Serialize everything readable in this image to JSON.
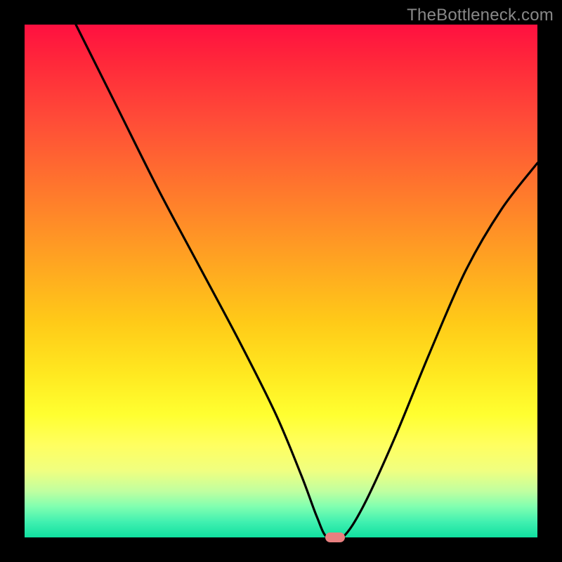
{
  "watermark": "TheBottleneck.com",
  "chart_data": {
    "type": "line",
    "title": "",
    "xlabel": "",
    "ylabel": "",
    "xlim": [
      0,
      100
    ],
    "ylim": [
      0,
      100
    ],
    "grid": false,
    "legend": false,
    "series": [
      {
        "name": "curve",
        "x": [
          10,
          18,
          26,
          34,
          42,
          49,
          54,
          57,
          59,
          62,
          66,
          72,
          79,
          86,
          93,
          100
        ],
        "y": [
          100,
          84,
          68,
          53,
          38,
          24,
          12,
          4,
          0,
          0,
          6,
          19,
          36,
          52,
          64,
          73
        ]
      }
    ],
    "marker": {
      "x": 60.5,
      "y": 0
    },
    "gradient_stops": [
      {
        "pos": 0.0,
        "color": "#ff1040"
      },
      {
        "pos": 0.5,
        "color": "#ffb520"
      },
      {
        "pos": 0.78,
        "color": "#ffff40"
      },
      {
        "pos": 1.0,
        "color": "#10e0a0"
      }
    ]
  }
}
